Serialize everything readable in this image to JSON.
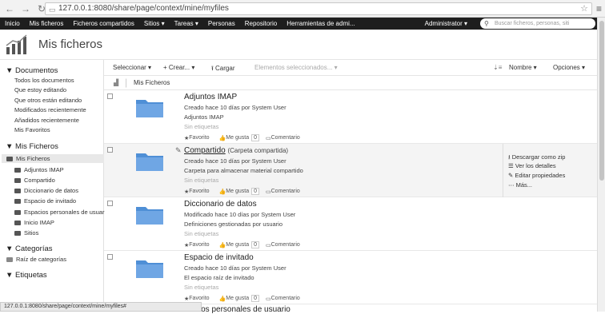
{
  "browser": {
    "back": "←",
    "forward": "→",
    "reload": "↻",
    "url": "127.0.0.1:8080/share/page/context/mine/myfiles",
    "star": "☆",
    "menu": "≡"
  },
  "nav": {
    "items": [
      "Inicio",
      "Mis ficheros",
      "Ficheros compartidos",
      "Sitios ▾",
      "Tareas ▾",
      "Personas",
      "Repositorio",
      "Herramientas de admi..."
    ],
    "admin": "Administrator ▾",
    "search_placeholder": "Buscar ficheros, personas, siti"
  },
  "page": {
    "title": "Mis ficheros"
  },
  "sidebar": {
    "documents": {
      "title": "▼ Documentos",
      "links": [
        "Todos los documentos",
        "Que estoy editando",
        "Que otros están editando",
        "Modificados recientemente",
        "Añadidos recientemente",
        "Mis Favoritos"
      ]
    },
    "myfiles": {
      "title": "▼ Mis Ficheros",
      "root": "Mis Ficheros",
      "children": [
        "Adjuntos IMAP",
        "Compartido",
        "Diccionario de datos",
        "Espacio de invitado",
        "Espacios personales de usuar",
        "Inicio IMAP",
        "Sitios"
      ]
    },
    "categories": {
      "title": "▼ Categorías",
      "root": "Raíz de categorías"
    },
    "tags": {
      "title": "▼ Etiquetas"
    }
  },
  "toolbar": {
    "select": "Seleccionar ▾",
    "create": "+ Crear... ▾",
    "upload": "Cargar",
    "selected": "Elementos seleccionados... ▾",
    "sort": "Nombre ▾",
    "options": "Opciones ▾"
  },
  "breadcrumb": "Mis Ficheros",
  "actions": {
    "favorite": "Favorito",
    "like": "Me gusta",
    "like_count": "0",
    "comment": "Comentario"
  },
  "rows": [
    {
      "title": "Adjuntos IMAP",
      "subtitle": "",
      "created": "Creado hace 10 días por System User",
      "desc": "Adjuntos IMAP",
      "tags": "Sin etiquetas"
    },
    {
      "title": "Compartido",
      "subtitle": "(Carpeta compartida)",
      "created": "Creado hace 10 días por System User",
      "desc": "Carpeta para almacenar material compartido",
      "tags": "Sin etiquetas"
    },
    {
      "title": "Diccionario de datos",
      "subtitle": "",
      "created": "Modificado hace 10 días por System User",
      "desc": "Definiciones gestionadas por usuario",
      "tags": "Sin etiquetas"
    },
    {
      "title": "Espacio de invitado",
      "subtitle": "",
      "created": "Creado hace 10 días por System User",
      "desc": "El espacio raíz de invitado",
      "tags": "Sin etiquetas"
    }
  ],
  "row_actions": [
    "Descargar como zip",
    "Ver los detalles",
    "Editar propiedades",
    "Más..."
  ],
  "partial_row": "...acios personales de usuario",
  "statusbar": "127.0.0.1:8080/share/page/context/mine/myfiles#"
}
